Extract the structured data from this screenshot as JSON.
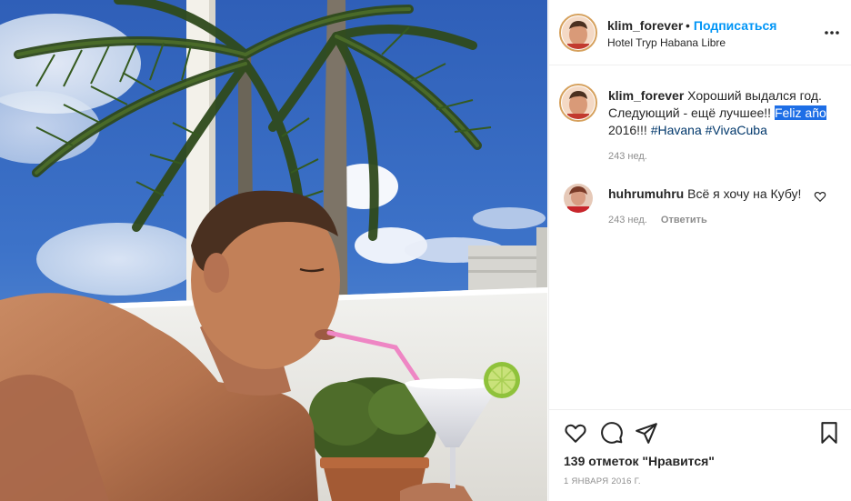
{
  "post": {
    "photo_icon": "photo",
    "header": {
      "username": "klim_forever",
      "dot": "•",
      "follow_label": "Подписаться",
      "location": "Hotel Tryp Habana Libre",
      "more_icon": "more-horizontal-icon"
    },
    "caption": {
      "username": "klim_forever",
      "text_part1": "Хороший выдался год. Следующий - ещё лучшее!! ",
      "highlight": "Feliz año",
      "text_part2": " 2016!!! ",
      "hashtag1": "#Havana",
      "hashtag2": "#VivaCuba",
      "time": "243 нед."
    },
    "comments": [
      {
        "username": "huhrumuhru",
        "text": "Всё я хочу на Кубу!",
        "time": "243 нед.",
        "reply_label": "Ответить",
        "like_icon": "heart-icon"
      }
    ],
    "actions": {
      "icons": [
        "heart-icon",
        "comment-icon",
        "share-icon",
        "bookmark-icon"
      ],
      "likes": "139 отметок \"Нравится\"",
      "date": "1 ЯНВАРЯ 2016 Г."
    },
    "colors": {
      "link_blue": "#0095f6",
      "hashtag": "#00376b",
      "highlight": "#1d6ee6",
      "muted": "#8e8e8e"
    }
  }
}
